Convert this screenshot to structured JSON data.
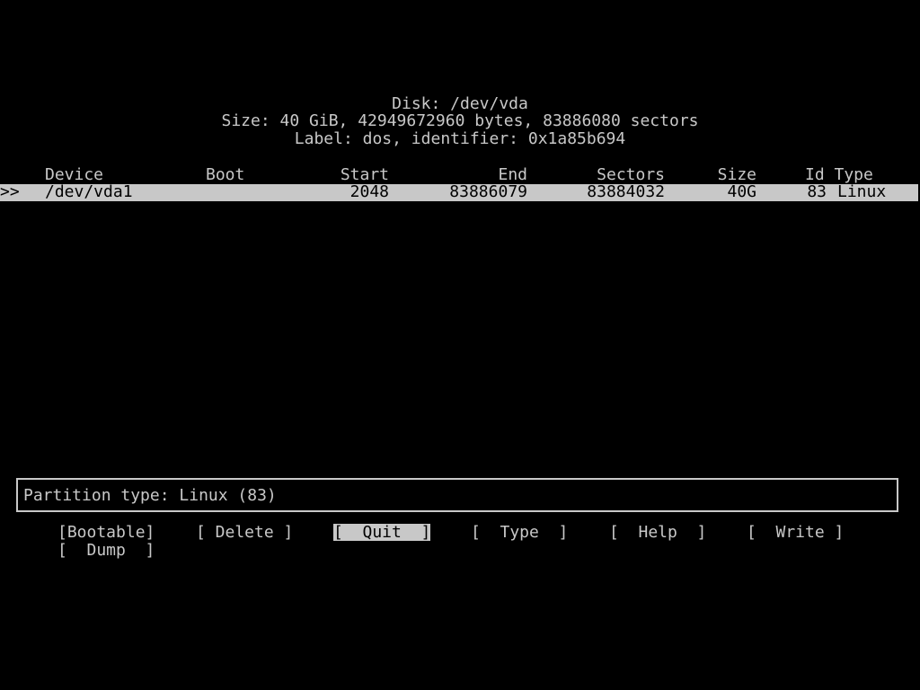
{
  "header": {
    "title": "Disk: /dev/vda",
    "size_line": "Size: 40 GiB, 42949672960 bytes, 83886080 sectors",
    "label_line": "Label: dos, identifier: 0x1a85b694"
  },
  "table": {
    "columns": {
      "device": "Device",
      "boot": "Boot",
      "start": "Start",
      "end": "End",
      "sectors": "Sectors",
      "size": "Size",
      "id_type": "Id Type"
    },
    "rows": [
      {
        "marker": ">>",
        "device": "/dev/vda1",
        "boot": "",
        "start": "2048",
        "end": "83886079",
        "sectors": "83884032",
        "size": "40G",
        "id": "83",
        "type": "Linux"
      }
    ]
  },
  "status": {
    "text": "Partition type: Linux (83)"
  },
  "menu": {
    "bootable": "[Bootable]",
    "delete": "[ Delete ]",
    "quit": "[  Quit  ]",
    "type": "[  Type  ]",
    "help": "[  Help  ]",
    "write": "[  Write ]",
    "dump": "[  Dump  ]",
    "selected": "quit"
  },
  "colors": {
    "background": "#000000",
    "foreground": "#c8c8c8",
    "highlight_bg": "#c8c8c8",
    "highlight_fg": "#000000"
  }
}
